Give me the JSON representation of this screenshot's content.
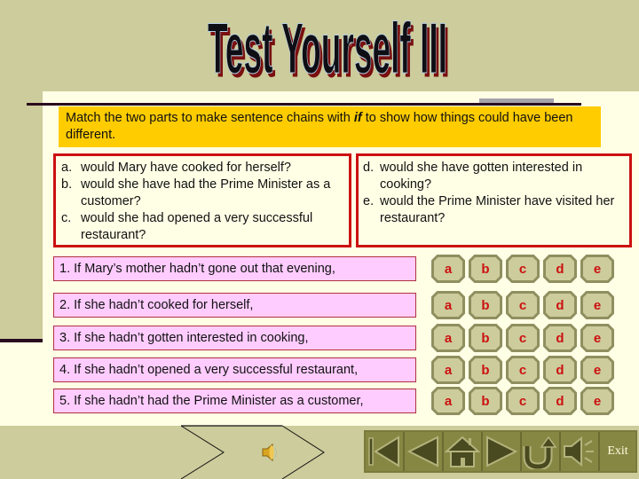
{
  "title": "Test Yourself III",
  "instruction": {
    "before": "Match the two parts to make sentence chains with ",
    "keyword": "if",
    "after": " to show how things could have been different."
  },
  "options_left": [
    {
      "letter": "a.",
      "text": "would Mary have cooked for herself?"
    },
    {
      "letter": "b.",
      "text": "would she have had the Prime Minister as a customer?"
    },
    {
      "letter": "c.",
      "text": "would she had opened a very successful restaurant?"
    }
  ],
  "options_right": [
    {
      "letter": "d.",
      "text": "would she have gotten interested in cooking?"
    },
    {
      "letter": "e.",
      "text": "would the Prime Minister have visited her restaurant?"
    }
  ],
  "prompts": [
    "1. If Mary’s mother hadn’t gone out that evening,",
    "2. If she hadn’t cooked for herself,",
    "3. If she hadn’t gotten interested in cooking,",
    "4. If she hadn’t opened a very successful restaurant,",
    "5. If she hadn’t had the Prime Minister as a customer,"
  ],
  "answer_choices": [
    "a",
    "b",
    "c",
    "d",
    "e"
  ],
  "audio": {
    "icon": "speaker-icon"
  },
  "nav": {
    "buttons": [
      {
        "name": "first-slide-button",
        "icon": "first-icon"
      },
      {
        "name": "previous-slide-button",
        "icon": "previous-icon"
      },
      {
        "name": "home-button",
        "icon": "home-icon"
      },
      {
        "name": "next-slide-button",
        "icon": "next-icon"
      },
      {
        "name": "return-button",
        "icon": "return-icon"
      },
      {
        "name": "sound-button",
        "icon": "sound-icon"
      }
    ],
    "exit_label": "Exit"
  },
  "colors": {
    "background": "#cccc9c",
    "panel": "#ffffe6",
    "instruction_bg": "#ffcc00",
    "option_border": "#cc1111",
    "prompt_bg": "#ffccff",
    "answer_bg": "#cccc9c",
    "answer_text": "#cc1111",
    "nav_bg": "#878744"
  }
}
